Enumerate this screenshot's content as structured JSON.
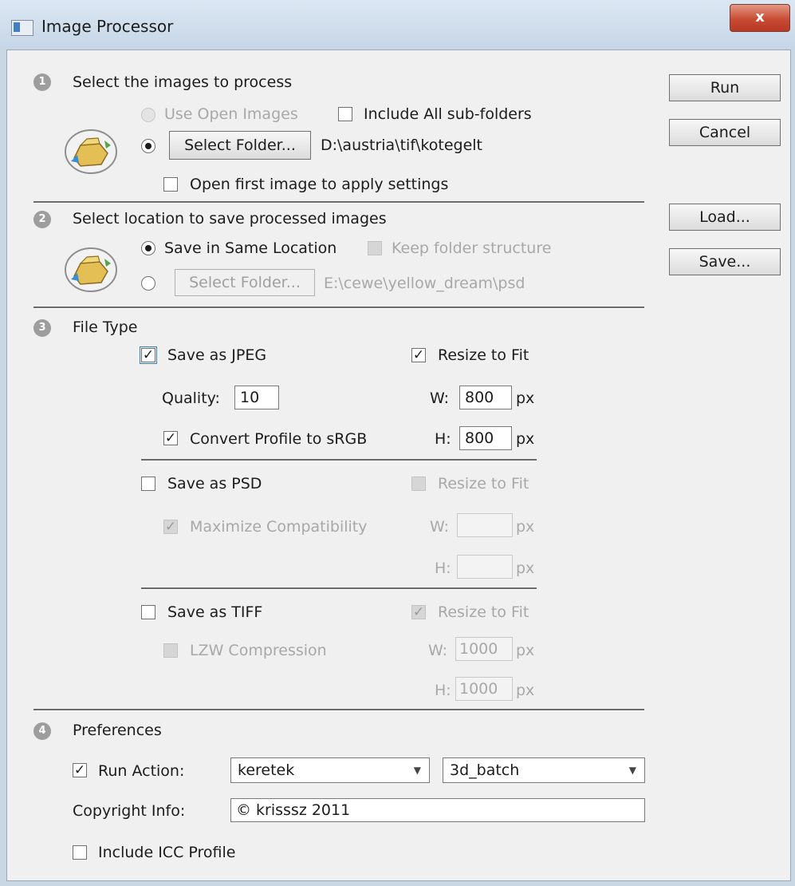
{
  "window": {
    "title": "Image Processor",
    "close_label": "x"
  },
  "buttons": {
    "run": "Run",
    "cancel": "Cancel",
    "load": "Load...",
    "save": "Save..."
  },
  "section1": {
    "number": "1",
    "title": "Select the images to process",
    "use_open_images": "Use Open Images",
    "include_subfolders": "Include All sub-folders",
    "select_folder": "Select Folder...",
    "folder_path": "D:\\austria\\tif\\kotegelt",
    "open_first_image": "Open first image to apply settings"
  },
  "section2": {
    "number": "2",
    "title": "Select location to save processed images",
    "save_same_location": "Save in Same Location",
    "keep_folder_structure": "Keep folder structure",
    "select_folder": "Select Folder...",
    "folder_path": "E:\\cewe\\yellow_dream\\psd"
  },
  "section3": {
    "number": "3",
    "title": "File Type",
    "jpeg": {
      "label": "Save as JPEG",
      "checked": true,
      "quality_label": "Quality:",
      "quality_value": "10",
      "convert_profile": "Convert Profile to sRGB",
      "resize_label": "Resize to Fit",
      "w_label": "W:",
      "w_value": "800",
      "h_label": "H:",
      "h_value": "800",
      "unit": "px"
    },
    "psd": {
      "label": "Save as PSD",
      "maximize": "Maximize Compatibility",
      "resize_label": "Resize to Fit",
      "w_label": "W:",
      "w_value": "",
      "h_label": "H:",
      "h_value": "",
      "unit": "px"
    },
    "tiff": {
      "label": "Save as TIFF",
      "lzw": "LZW Compression",
      "resize_label": "Resize to Fit",
      "w_label": "W:",
      "w_value": "1000",
      "h_label": "H:",
      "h_value": "1000",
      "unit": "px"
    }
  },
  "section4": {
    "number": "4",
    "title": "Preferences",
    "run_action_label": "Run Action:",
    "action_set": "keretek",
    "action": "3d_batch",
    "copyright_label": "Copyright Info:",
    "copyright_value": "© krisssz 2011",
    "include_icc": "Include ICC Profile"
  },
  "glyphs": {
    "check": "✓",
    "dropdown": "▼"
  },
  "icons": [
    "folder-icon",
    "close-icon",
    "dropdown-arrow-icon"
  ],
  "colors": {
    "title_bar": "#c6d6e7",
    "close_button": "#c94b34",
    "dialog_background": "#f0f0f0",
    "disabled_text": "#a8a8a8",
    "section_number": "#9d9d9d"
  }
}
